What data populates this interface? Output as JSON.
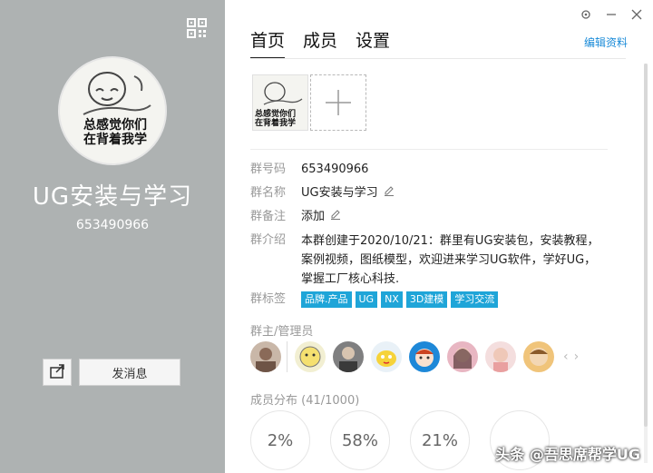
{
  "left": {
    "group_name": "UG安装与学习",
    "group_id": "653490966",
    "avatar_caption": "总感觉你们\n在背着我学",
    "send_message": "发消息"
  },
  "window": {
    "icons": [
      "settings-icon",
      "minimize-icon",
      "close-icon"
    ]
  },
  "tabs": [
    {
      "label": "首页",
      "active": true
    },
    {
      "label": "成员",
      "active": false
    },
    {
      "label": "设置",
      "active": false
    }
  ],
  "edit_profile": "编辑资料",
  "info": {
    "number_label": "群号码",
    "number_value": "653490966",
    "name_label": "群名称",
    "name_value": "UG安装与学习",
    "remark_label": "群备注",
    "remark_value": "添加",
    "intro_label": "群介绍",
    "intro_value": "本群创建于2020/10/21：群里有UG安装包，安装教程，案例视频，图纸模型，欢迎进来学习UG软件，学好UG，掌握工厂核心科技.",
    "tags_label": "群标签",
    "tags": [
      "品牌.产品",
      "UG",
      "NX",
      "3D建模",
      "学习交流"
    ]
  },
  "admins_label": "群主/管理员",
  "distribution_label": "成员分布 (41/1000)",
  "distribution": [
    "2%",
    "58%",
    "21%",
    ""
  ],
  "watermark": "头条 @吾思席帮学UG",
  "colors": {
    "tag_bg": "#1fa5d8",
    "left_panel": "#aeb2b2",
    "link": "#1a8bd8"
  }
}
